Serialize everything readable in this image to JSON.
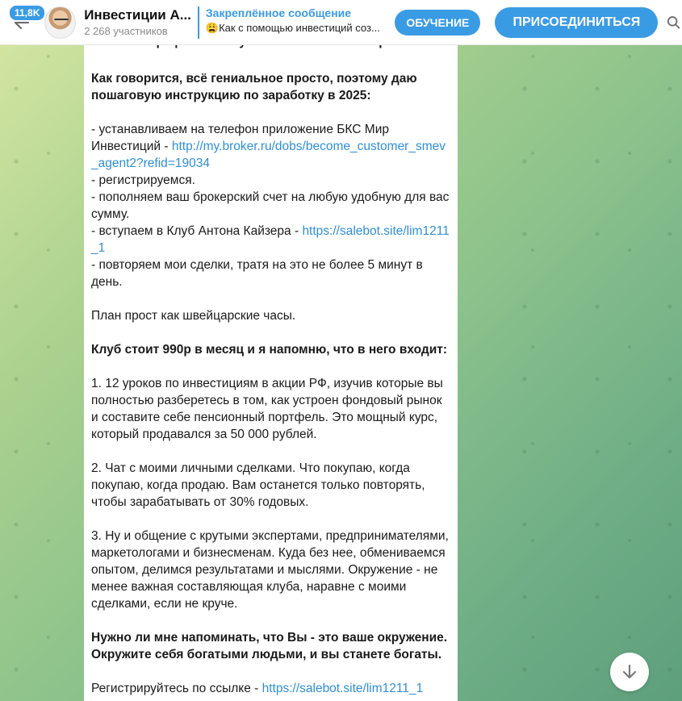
{
  "header": {
    "unread_count": "11,8K",
    "chat_title": "Инвестиции А...",
    "members": "2 268 участников",
    "pinned_title": "Закреплённое сообщение",
    "pinned_text": "😩Как с помощью инвестиций соз...",
    "learn_button": "ОБУЧЕНИЕ",
    "join_button": "ПРИСОЕДИНИТЬСЯ"
  },
  "message": {
    "cut_line": "сложных графиков и изучения непонятных терминов.",
    "intro": "Как говорится, всё гениальное просто, поэтому даю пошаговую инструкцию по заработку в 2025:",
    "step1_text": "- устанавливаем на телефон приложение БКС Мир Инвестиций - ",
    "step1_link": "http://my.broker.ru/dobs/become_customer_smev_agent2?refid=19034",
    "step2": "- регистрируемся.",
    "step3": "- пополняем ваш брокерский счет на любую удобную для вас сумму.",
    "step4_text": "- вступаем в Клуб Антона Кайзера - ",
    "step4_link": "https://salebot.site/lim1211_1",
    "step5": "- повторяем мои сделки, тратя на это не более 5 минут в день.",
    "plan": "План прост как швейцарские часы.",
    "price": "Клуб стоит 990р в месяц и я напомню, что в него входит:",
    "item1": "1. 12 уроков по инвестициям в акции РФ, изучив которые вы полностью разберетесь в том, как устроен фондовый рынок и составите себе пенсионный портфель. Это мощный курс, который продавался за 50 000 рублей.",
    "item2": "2. Чат с моими личными сделками. Что покупаю, когда покупаю, когда продаю. Вам останется только повторять, чтобы зарабатывать от 30% годовых.",
    "item3": "3. Ну и общение с крутыми экспертами, предпринимателями, маркетологами и бизнесменам. Куда без нее, обмениваемся опытом, делимся результатами и мыслями. Окружение - не менее важная составляющая клуба, наравне с моими сделками, если не круче.",
    "closing": "Нужно ли мне напоминать, что Вы - это ваше окружение. Окружите себя богатыми людьми, и вы станете богаты.",
    "register_text": "Регистрируйтесь по ссылке - ",
    "register_link": "https://salebot.site/lim1211_1"
  },
  "icons": {
    "back": "arrow-left-icon",
    "search": "search-icon",
    "scroll": "arrow-down-icon"
  },
  "colors": {
    "accent": "#3a9be5",
    "link": "#2f8fd8"
  }
}
